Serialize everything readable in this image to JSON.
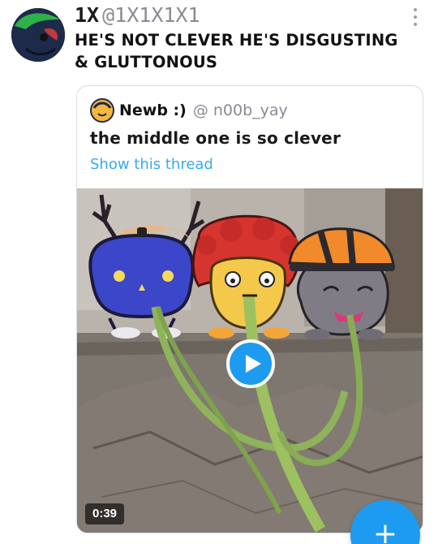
{
  "tweet": {
    "author": {
      "display_name": "1X",
      "handle": "@1X1X1X1",
      "avatar_icon": "green-wisp-avatar-icon"
    },
    "more_icon": "more-vertical-icon",
    "text": "HE'S NOT CLEVER HE'S DISGUSTING & GLUTTONOUS"
  },
  "quote": {
    "author": {
      "display_name": "Newb :)",
      "handle": "@ n00b_yay",
      "avatar_icon": "yellow-face-avatar-icon"
    },
    "text": "the middle one is so clever",
    "show_thread": "Show this thread",
    "media": {
      "type": "video",
      "play_icon": "play-icon",
      "duration": "0:39"
    }
  },
  "fab": {
    "icon": "plus",
    "color": "#1d9bf0"
  },
  "colors": {
    "accent": "#1d9bf0",
    "link": "#36aaf2",
    "muted": "#888b93"
  }
}
